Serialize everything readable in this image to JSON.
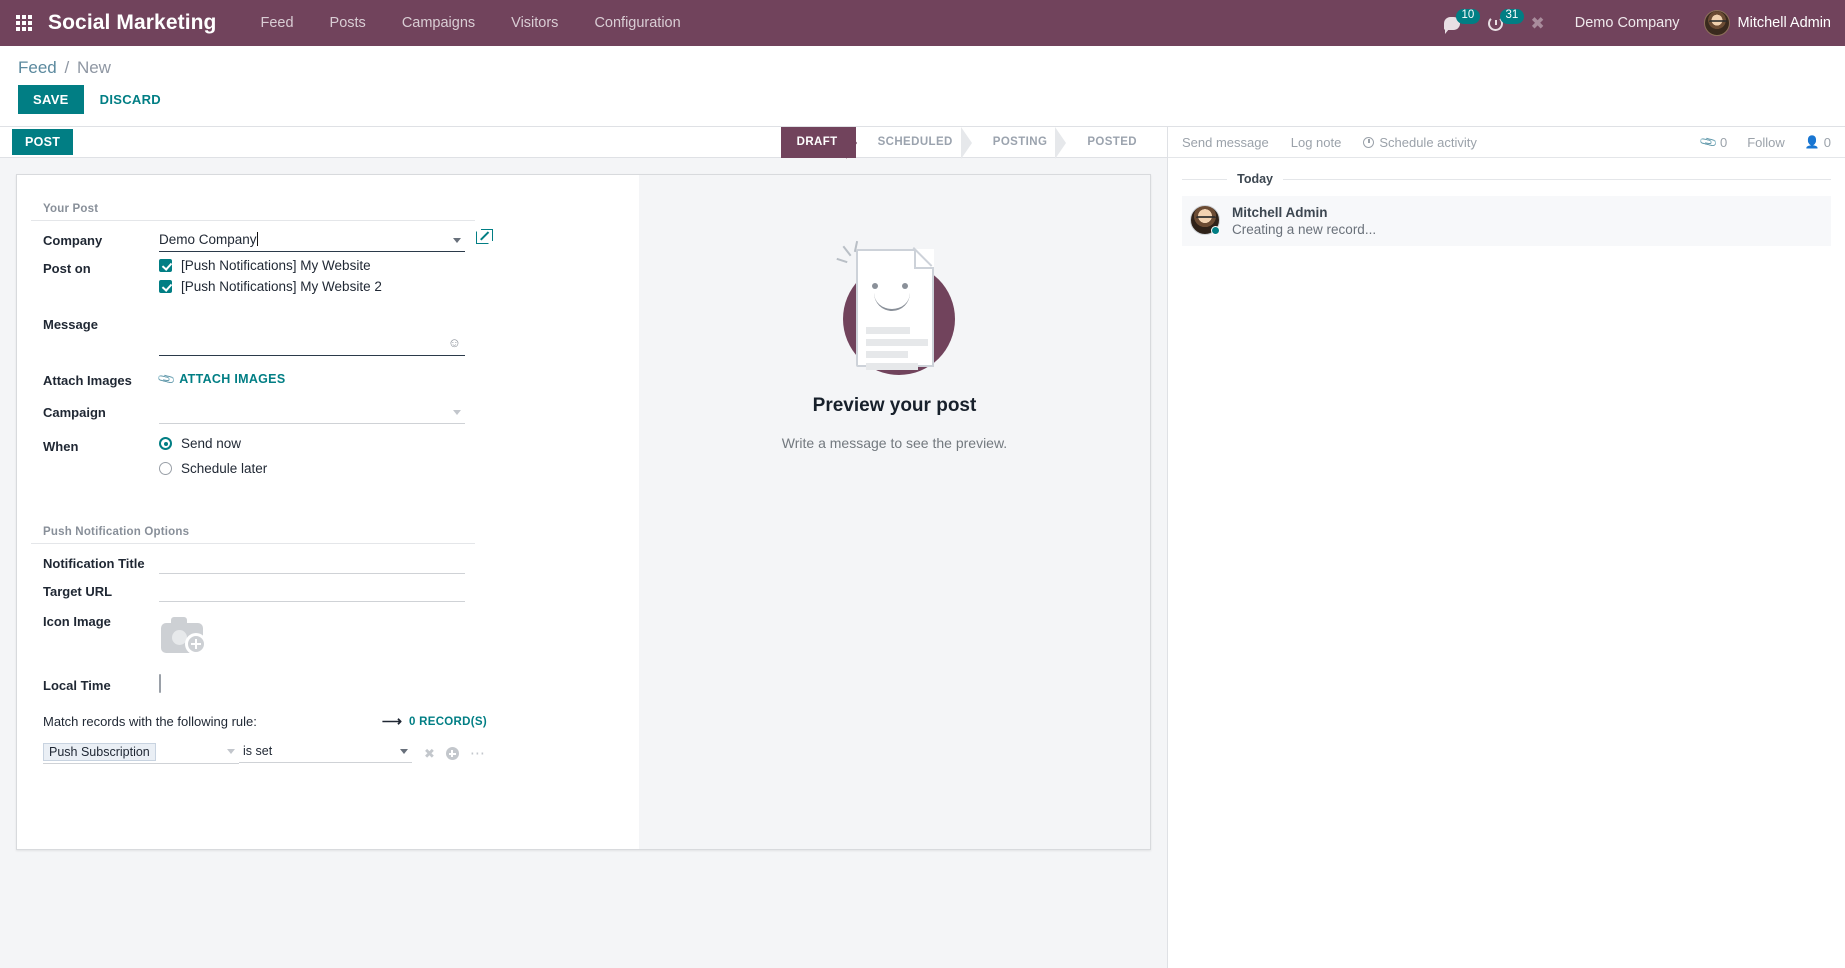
{
  "navbar": {
    "apps_icon": "apps-grid-icon",
    "brand": "Social Marketing",
    "menu": [
      "Feed",
      "Posts",
      "Campaigns",
      "Visitors",
      "Configuration"
    ],
    "messages_icon": "speech-bubble-icon",
    "messages_count": "10",
    "activities_icon": "clock-icon",
    "activities_count": "31",
    "debug_icon": "wrench-icon",
    "company": "Demo Company",
    "user_avatar_icon": "user-avatar",
    "user": "Mitchell Admin",
    "brand_color": "#71435c",
    "badge_color": "#017e84"
  },
  "control_panel": {
    "breadcrumb_root": "Feed",
    "breadcrumb_sep": "/",
    "breadcrumb_current": "New",
    "save_label": "SAVE",
    "discard_label": "DISCARD",
    "accent_color": "#017e84"
  },
  "statusbar": {
    "post_label": "POST",
    "stages": [
      "DRAFT",
      "SCHEDULED",
      "POSTING",
      "POSTED"
    ],
    "active_stage": "DRAFT"
  },
  "form": {
    "group_your_post": "Your Post",
    "group_push_options": "Push Notification Options",
    "company": {
      "label": "Company",
      "value": "Demo Company",
      "dropdown_icon": "chevron-down-icon",
      "internal_link_icon": "external-link-icon"
    },
    "post_on": {
      "label": "Post on",
      "options": [
        {
          "label": "[Push Notifications] My Website",
          "checked": true
        },
        {
          "label": "[Push Notifications] My Website 2",
          "checked": true
        }
      ]
    },
    "message": {
      "label": "Message",
      "value": "",
      "placeholder": "",
      "emoji_icon": "smiley-icon"
    },
    "attach_images": {
      "label": "Attach Images",
      "button_label": "ATTACH IMAGES",
      "icon": "paperclip-icon"
    },
    "campaign": {
      "label": "Campaign",
      "value": "",
      "dropdown_icon": "chevron-down-icon"
    },
    "when": {
      "label": "When",
      "options": [
        {
          "label": "Send now",
          "selected": true
        },
        {
          "label": "Schedule later",
          "selected": false
        }
      ]
    },
    "notification_title": {
      "label": "Notification Title",
      "value": ""
    },
    "target_url": {
      "label": "Target URL",
      "value": ""
    },
    "icon_image": {
      "label": "Icon Image",
      "placeholder_icon": "camera-add-icon"
    },
    "local_time": {
      "label": "Local Time",
      "checked": false
    },
    "domain": {
      "text": "Match records with the following rule:",
      "arrow_icon": "arrow-right-icon",
      "records_label": "0 RECORD(S)",
      "field": "Push Subscription",
      "operator": "is set",
      "remove_icon": "close-icon",
      "add_icon": "plus-circle-icon",
      "more_icon": "ellipsis-icon"
    }
  },
  "preview": {
    "art_icon": "document-smiley-illustration",
    "title": "Preview your post",
    "subtitle": "Write a message to see the preview."
  },
  "chatter": {
    "send_message": "Send message",
    "log_note": "Log note",
    "schedule_activity": "Schedule activity",
    "schedule_activity_icon": "clock-icon",
    "attachment_icon": "paperclip-icon",
    "attachment_count": "0",
    "follow_label": "Follow",
    "followers_icon": "person-icon",
    "followers_count": "0",
    "day_separator": "Today",
    "messages": [
      {
        "author": "Mitchell Admin",
        "body": "Creating a new record...",
        "avatar_icon": "user-avatar",
        "online": true
      }
    ]
  }
}
